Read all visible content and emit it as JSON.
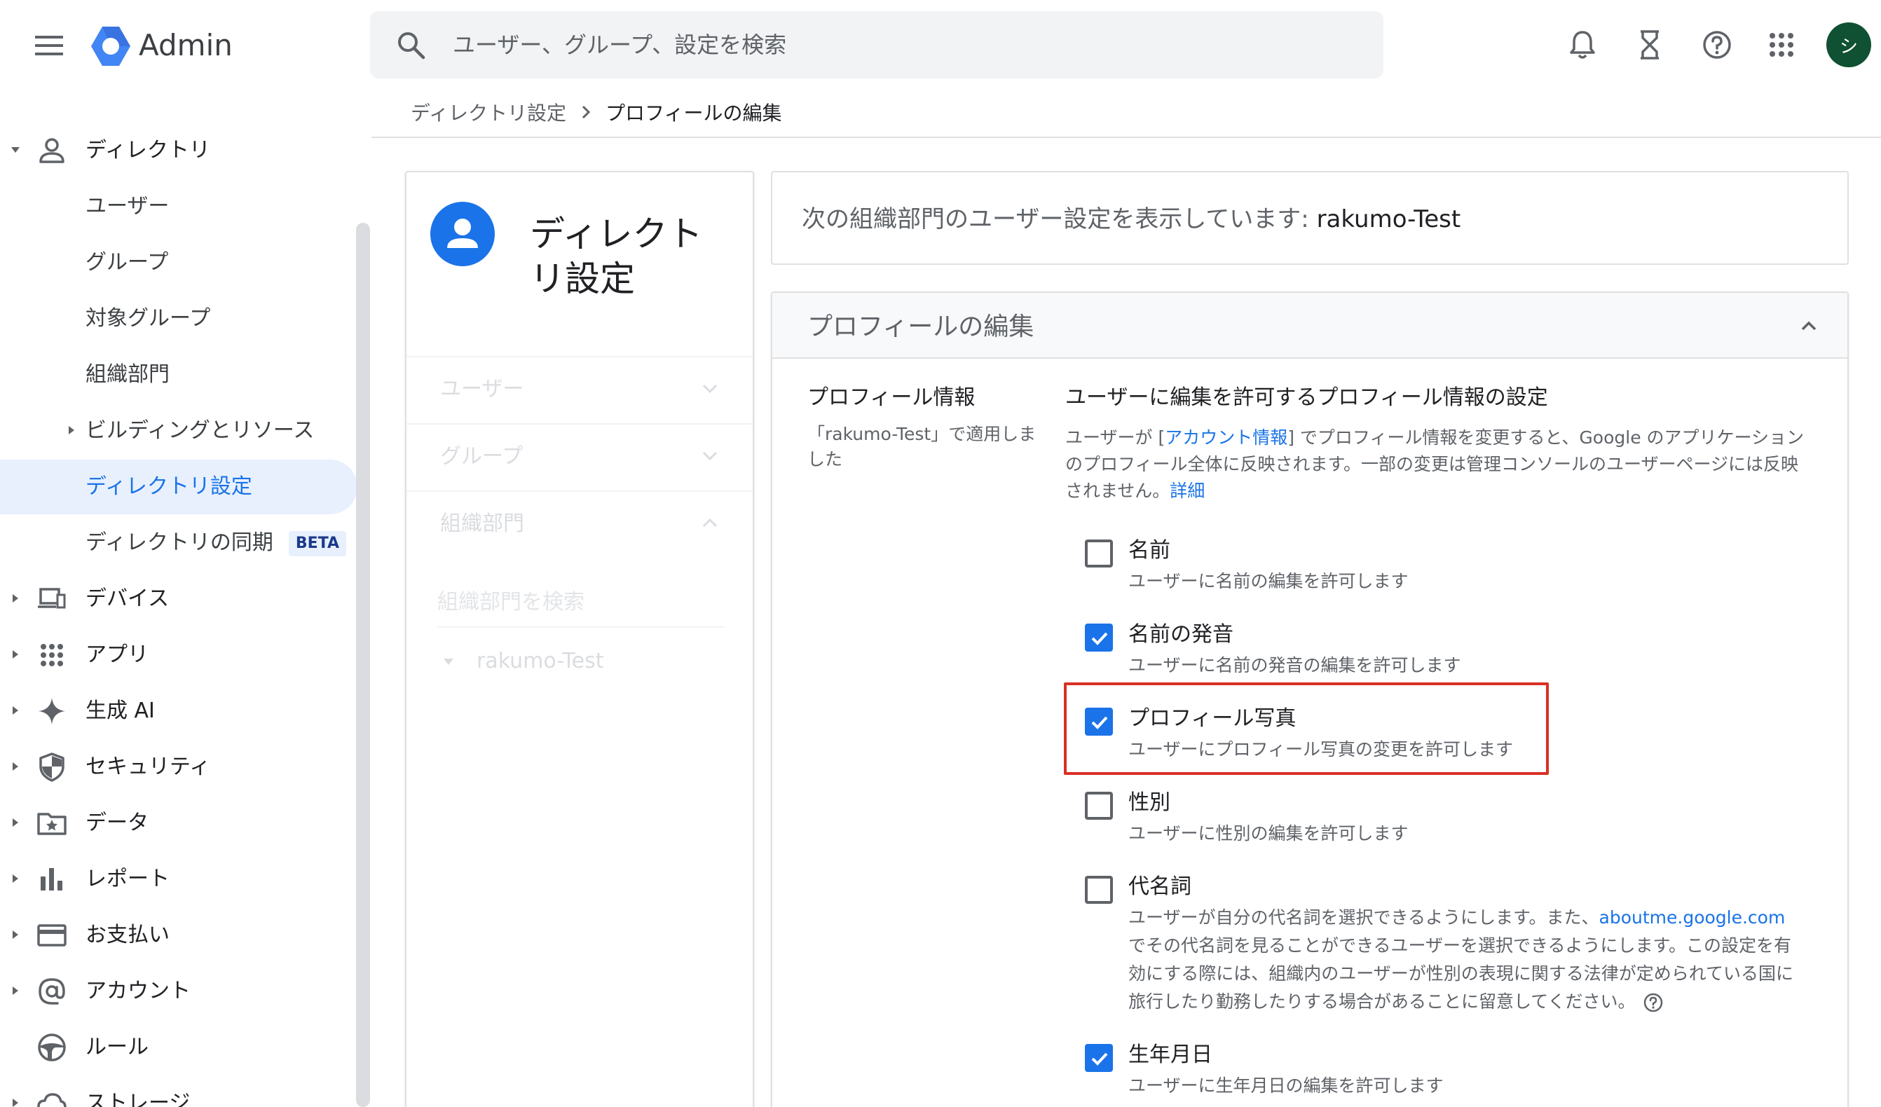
{
  "header": {
    "brand": "Admin",
    "search_placeholder": "ユーザー、グループ、設定を検索",
    "avatar_initial": "シ",
    "icons": [
      "menu-icon",
      "google-admin-logo",
      "search-icon",
      "bell-icon",
      "hourglass-icon",
      "help-icon",
      "apps-grid-icon"
    ]
  },
  "sidebar": {
    "directory": "ディレクトリ",
    "users": "ユーザー",
    "groups": "グループ",
    "target_groups": "対象グループ",
    "org_units": "組織部門",
    "buildings": "ビルディングとリソース",
    "directory_settings": "ディレクトリ設定",
    "directory_sync": "ディレクトリの同期",
    "beta": "BETA",
    "devices": "デバイス",
    "apps": "アプリ",
    "gen_ai": "生成 AI",
    "security": "セキュリティ",
    "data": "データ",
    "reports": "レポート",
    "billing": "お支払い",
    "account": "アカウント",
    "rules": "ルール",
    "storage": "ストレージ"
  },
  "breadcrumb": {
    "parent": "ディレクトリ設定",
    "current": "プロフィールの編集"
  },
  "left_card": {
    "title": "ディレクトリ設定",
    "sections": [
      "ユーザー",
      "グループ",
      "組織部門"
    ],
    "search_placeholder": "組織部門を検索",
    "tree_root": "rakumo-Test"
  },
  "banner": {
    "text": "次の組織部門のユーザー設定を表示しています: ",
    "org_unit": "rakumo-Test"
  },
  "panel": {
    "title": "プロフィールの編集",
    "section_label": "プロフィール情報",
    "section_note": "「rakumo-Test」で適用しました",
    "settings_title": "ユーザーに編集を許可するプロフィール情報の設定",
    "desc_before": "ユーザーが [",
    "desc_link": "アカウント情報",
    "desc_after": "] でプロフィール情報を変更すると、Google のアプリケーションのプロフィール全体に反映されます。一部の変更は管理コンソールのユーザーページには反映されません。",
    "desc_more": "詳細",
    "options": [
      {
        "label": "名前",
        "desc": "ユーザーに名前の編集を許可します",
        "checked": false
      },
      {
        "label": "名前の発音",
        "desc": "ユーザーに名前の発音の編集を許可します",
        "checked": true
      },
      {
        "label": "プロフィール写真",
        "desc": "ユーザーにプロフィール写真の変更を許可します",
        "checked": true
      },
      {
        "label": "性別",
        "desc": "ユーザーに性別の編集を許可します",
        "checked": false
      },
      {
        "label": "代名詞",
        "desc_before": "ユーザーが自分の代名詞を選択できるようにします。また、",
        "desc_link": "aboutme.google.com",
        "desc_after": " でその代名詞を見ることができるユーザーを選択できるようにします。この設定を有効にする際には、組織内のユーザーが性別の表現に関する法律が定められている国に旅行したり勤務したりする場合があることに留意してください。",
        "checked": false
      },
      {
        "label": "生年月日",
        "desc": "ユーザーに生年月日の編集を許可します",
        "checked": true
      }
    ]
  },
  "colors": {
    "accent": "#1a73e8",
    "highlight": "#d93025",
    "active_nav_bg": "#e8f0fe",
    "avatar_bg": "#0f5132"
  }
}
